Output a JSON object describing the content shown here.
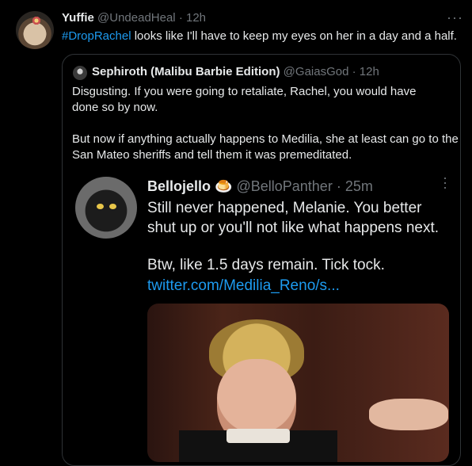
{
  "tweet": {
    "display_name": "Yuffie",
    "handle": "@UndeadHeal",
    "separator": "·",
    "time": "12h",
    "more": "···",
    "hashtag": "#DropRachel",
    "text": " looks like I'll have to keep my eyes on her in a day and a half."
  },
  "quote": {
    "display_name": "Sephiroth (Malibu Barbie Edition)",
    "handle": "@GaiasGod",
    "separator": "·",
    "time": "12h",
    "paragraph1": "Disgusting. If you were going to retaliate, Rachel, you would have done so by now.",
    "paragraph2": "But now if anything actually happens to Medilia, she at least can go to the San Mateo sheriffs and tell them it was premeditated."
  },
  "inner": {
    "display_name": "Bellojello",
    "emoji": "🍮",
    "handle": "@BelloPanther",
    "separator": "·",
    "time": "25m",
    "more": "···",
    "text1": "Still never happened, Melanie. You better shut up or you'll not like what happens next.",
    "text2": "Btw, like 1.5 days remain. Tick tock.",
    "link": "twitter.com/Medilia_Reno/s..."
  }
}
